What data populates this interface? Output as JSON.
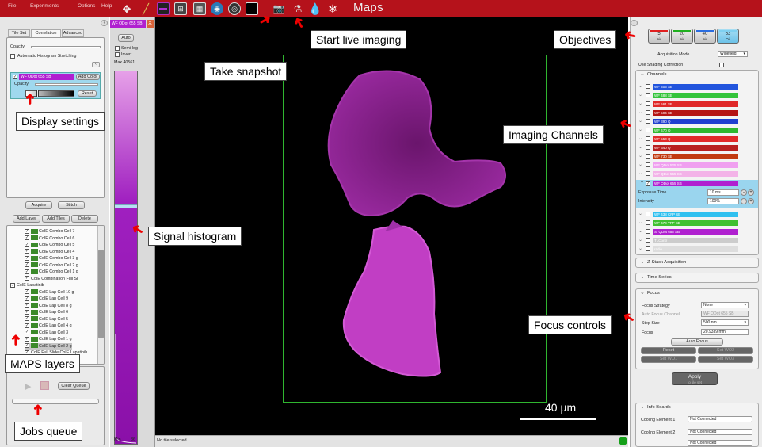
{
  "menu": {
    "file": "File",
    "experiments": "Experiments",
    "options": "Options",
    "help": "Help"
  },
  "app_title": "Maps",
  "left": {
    "tabs": [
      "Tile Set",
      "Correlation",
      "Advanced"
    ],
    "opacity_label": "Opacity",
    "auto_hist_label": "Automatic Histogram Stretching",
    "layer_title": "WF QDot 655 SB",
    "add_color": "Add Color",
    "opacity2": "Opacity",
    "reset": "Reset",
    "acquire": "Acquire",
    "stitch": "Stitch",
    "add_layer": "Add Layer",
    "add_tiles": "Add Tiles",
    "delete": "Delete",
    "tree": [
      "CoIE Combo Cell 7",
      "CoIE Combo Cell 6",
      "CoIE Combo Cell 5",
      "CoIE Combo Cell 4",
      "CoIE Combo Cell 3 g",
      "CoIE Combo Cell 2 g",
      "CoIE Combo Cell 1 g",
      "CoIE Combination Full Sli",
      "CoIE Lapatinib",
      "CoIE Lap Cell 10 g",
      "CoIE Lap Cell 9",
      "CoIE Lap Cell 8 g",
      "CoIE Lap Cell 6",
      "CoIE Lap Cell 5",
      "CoIE Lap Cell 4 g",
      "CoIE Lap Cell 3",
      "CoIE Lap Cell 1 g",
      "CoIE Lap Cell 2 g",
      "CoIE Full Slide CoIE Lapatinib"
    ],
    "clear_queue": "Clear Queue"
  },
  "hist": {
    "tab": "WF QDot 655 SB",
    "close": "X",
    "auto": "Auto",
    "semilog": "Semi-log",
    "invert": "Invert",
    "max": "Max 40561",
    "min": "Min",
    "min_val": "86"
  },
  "status": {
    "text": "No tile selected"
  },
  "scale_bar": "40 µm",
  "right": {
    "objectives": [
      {
        "mag": "5",
        "type": "Air",
        "color": "#e02020"
      },
      {
        "mag": "20",
        "type": "Air",
        "color": "#20b020"
      },
      {
        "mag": "40",
        "type": "Air",
        "color": "#2a6de0"
      },
      {
        "mag": "63",
        "type": "Oil",
        "color": "#7fd0f0"
      }
    ],
    "acq_mode_label": "Acquisition Mode",
    "acq_mode": "Widefield",
    "shading": "Use Shading Correction",
    "channels_title": "Channels",
    "channels": [
      {
        "name": "WF 405 SB",
        "color": "#2255dd"
      },
      {
        "name": "WF 488 SB",
        "color": "#33c43a"
      },
      {
        "name": "WF 561 SB",
        "color": "#e02828"
      },
      {
        "name": "WF 594 SB",
        "color": "#b51414"
      },
      {
        "name": "WF 390 Q",
        "color": "#1f3fd0"
      },
      {
        "name": "WF 470 Q",
        "color": "#2fb82f"
      },
      {
        "name": "WF 550 Q",
        "color": "#e22a2a"
      },
      {
        "name": "WF 640 Q",
        "color": "#b82020"
      },
      {
        "name": "WF 730 SB",
        "color": "#c23a10"
      },
      {
        "name": "WF QDot 525 SB",
        "color": "#f0a0f0"
      },
      {
        "name": "WF QDot 565 SB",
        "color": "#f3b3e8"
      },
      {
        "name": "WF QDot 655 SB",
        "color": "#b020d0"
      }
    ],
    "exposure_label": "Exposure Time",
    "exposure": "10 ms",
    "intensity_label": "Intensity",
    "intensity": "100%",
    "channels2": [
      {
        "name": "WF 438 CFP SB",
        "color": "#2fc0f0"
      },
      {
        "name": "WF 470 YFP SB",
        "color": "#40c030"
      },
      {
        "name": "SI QDot 655 SB",
        "color": "#b020d0"
      },
      {
        "name": "TLContr",
        "color": "#cccccc"
      },
      {
        "name": "radio",
        "color": "#dddddd"
      }
    ],
    "zstack": "Z-Stack Acquisition",
    "timeseries": "Time Series",
    "focus_title": "Focus",
    "focus_strategy_label": "Focus Strategy",
    "focus_strategy": "None",
    "auto_focus_channel_label": "Auto Focus Channel",
    "auto_focus_channel": "WF QDot 655 SB",
    "step_size_label": "Step Size",
    "step_size": "500 nm",
    "focus_label": "Focus",
    "focus_val": "20.9339 mm",
    "auto_focus": "Auto Focus",
    "reset": "Reset",
    "set_wo2": "Set WO2",
    "set_wo1": "Set WO1",
    "set_wo3": "Set WO3",
    "apply": "Apply",
    "apply_sub": "to tile set",
    "info_boards": "Info Boards",
    "cooling1_label": "Cooling Element 1",
    "cooling1": "Not Connected",
    "cooling2_label": "Cooling Element 2",
    "cooling2": "Not Connected",
    "cooling3": "Not Connected"
  },
  "callouts": {
    "live": "Start live imaging",
    "snapshot": "Take snapshot",
    "objectives": "Objectives",
    "display": "Display settings",
    "channels": "Imaging Channels",
    "histogram": "Signal histogram",
    "focus": "Focus controls",
    "layers": "MAPS layers",
    "jobs": "Jobs queue"
  }
}
